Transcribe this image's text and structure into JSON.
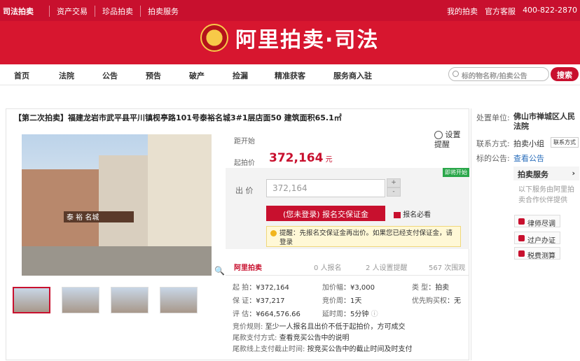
{
  "topbar": {
    "brand": "司法拍卖",
    "links": [
      "资产交易",
      "珍品拍卖",
      "拍卖服务"
    ],
    "my_auction": "我的拍卖",
    "service": "官方客服",
    "phone": "400-822-2870"
  },
  "hero": {
    "title": "阿里拍卖·司法"
  },
  "mainnav": {
    "items": [
      "首页",
      "法院",
      "公告",
      "预告",
      "破产",
      "捡漏",
      "精准获客",
      "服务商入驻"
    ],
    "search_placeholder": "标的物名称/拍卖公告",
    "search_button": "搜索"
  },
  "lot": {
    "title": "【第二次拍卖】福建龙岩市武平县平川镇枧亭路101号泰裕名城3#1层店面50 建筑面积65.1㎡",
    "photo_sign": "泰 裕 名城",
    "countdown_label": "距开始",
    "remind_label": "设置提醒",
    "start_price_label": "起拍价",
    "start_price": "372,164",
    "currency_unit": "元",
    "status_tag": "即将开始",
    "bid_label": "出 价",
    "bid_value": "372,164",
    "plus": "+",
    "minus": "-",
    "signup_button": "(您未登录) 报名交保证金",
    "must_read": "报名必看",
    "warning": "提醒：先报名交保证金再出价。如果您已经支付保证金，请登录"
  },
  "stats": {
    "brand": "阿里拍卖",
    "signups": "0",
    "signups_label": "人报名",
    "reminders": "2",
    "reminders_label": "人设置提醒",
    "views": "567",
    "views_label": "次围观"
  },
  "details": {
    "start": {
      "label": "起 拍",
      "value": "¥372,164"
    },
    "deposit": {
      "label": "保 证",
      "value": "¥37,217"
    },
    "assess": {
      "label": "评 估",
      "value": "¥664,576.66"
    },
    "increment": {
      "label": "加价幅",
      "value": "¥3,000"
    },
    "period": {
      "label": "竞价周",
      "value": "1天"
    },
    "extend": {
      "label": "延时周",
      "value": "5分钟"
    },
    "type": {
      "label": "类 型",
      "value": "拍卖"
    },
    "priority": {
      "label": "优先购买权",
      "value": "无"
    },
    "rule_label": "竞价规则:",
    "rule_text": "至少一人报名且出价不低于起拍价，方可成交",
    "pay_label": "尾款支付方式:",
    "pay_text": "查看竞买公告中的说明",
    "deadline_label": "尾款线上支付截止时间:",
    "deadline_text": "按竞买公告中的截止时间及时支付"
  },
  "side": {
    "unit_label": "处置单位:",
    "unit_value": "佛山市禅城区人民法院",
    "contact_label": "联系方式:",
    "contact_value": "拍卖小组",
    "contact_badge": "联系方式",
    "notice_label": "标的公告:",
    "notice_link": "查看公告",
    "service_title": "拍卖服务",
    "service_desc": "以下服务由阿里拍卖合作伙伴提供",
    "btn_lawyer": "律师尽调",
    "btn_transfer": "过户办证",
    "btn_tax": "税费测算"
  }
}
